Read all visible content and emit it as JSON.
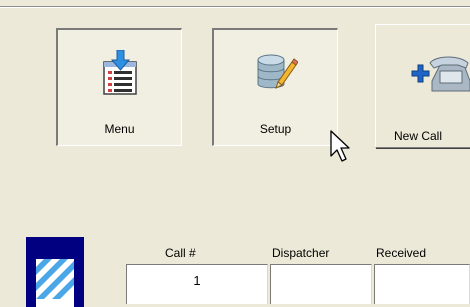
{
  "toolbar": {
    "menu": {
      "label": "Menu",
      "icon": "menu-list-icon"
    },
    "setup": {
      "label": "Setup",
      "icon": "database-edit-icon"
    },
    "new_call": {
      "label": "New Call",
      "icon": "add-phone-icon"
    }
  },
  "call_form": {
    "columns": {
      "call_number": "Call #",
      "dispatcher": "Dispatcher",
      "received": "Received"
    },
    "values": {
      "call_number": "1",
      "dispatcher": "",
      "received": ""
    }
  },
  "colors": {
    "background": "#ECE9D8",
    "logo": "#000080"
  }
}
